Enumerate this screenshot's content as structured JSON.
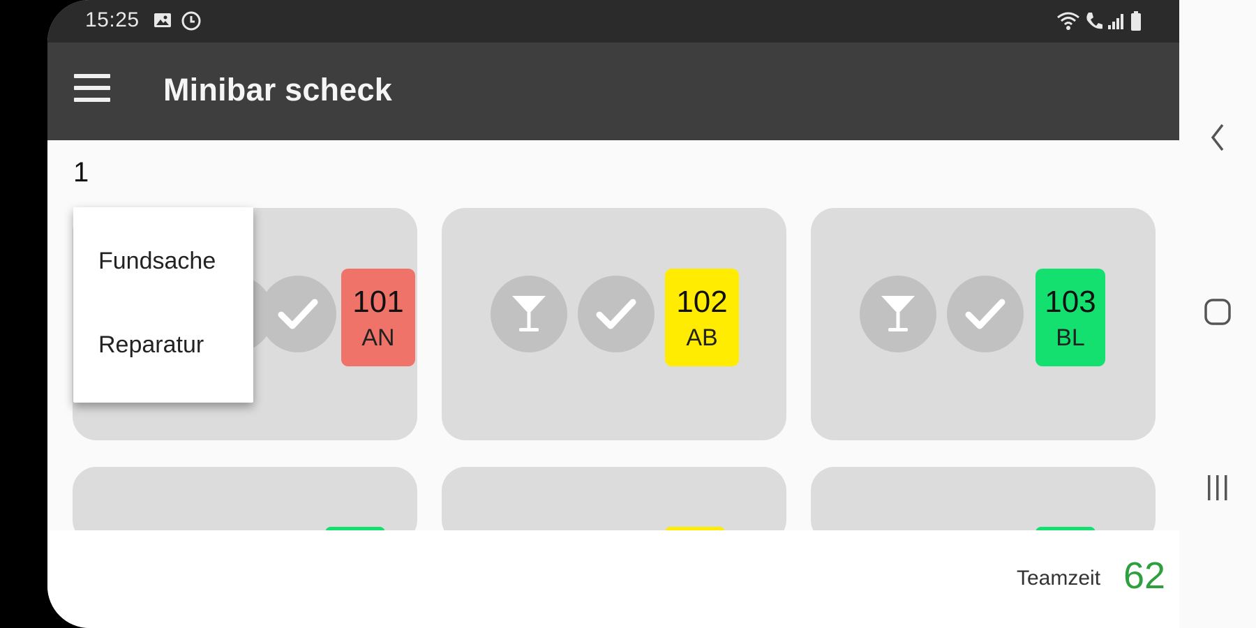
{
  "status_bar": {
    "time": "15:25"
  },
  "app_bar": {
    "title": "Minibar scheck"
  },
  "floor": {
    "label": "1"
  },
  "colors": {
    "red": "#ef7369",
    "yellow": "#ffec00",
    "green": "#14e06f",
    "accent_green": "#2e9e3e"
  },
  "rooms": [
    {
      "number": "101",
      "status": "AN",
      "color": "#ef7369"
    },
    {
      "number": "102",
      "status": "AB",
      "color": "#ffec00"
    },
    {
      "number": "103",
      "status": "BL",
      "color": "#14e06f"
    }
  ],
  "popup_menu": {
    "items": [
      {
        "label": "Fundsache"
      },
      {
        "label": "Reparatur"
      }
    ]
  },
  "footer": {
    "team_label": "Teamzeit",
    "team_value": "62"
  },
  "icons": {
    "minibar": "cocktail-icon",
    "done": "check-icon",
    "menu": "hamburger-menu-icon",
    "nav_back": "chevron-left-icon",
    "nav_home": "home-icon",
    "nav_recents": "recent-apps-icon"
  }
}
